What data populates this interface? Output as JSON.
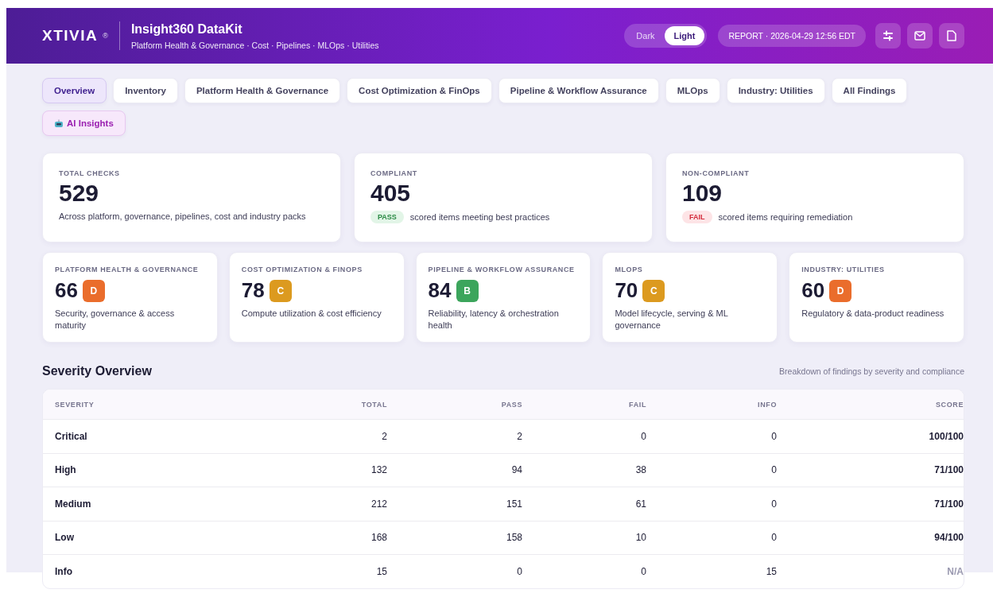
{
  "header": {
    "logo": "XTIVIA",
    "logo_mark": "®",
    "title": "Insight360 DataKit",
    "subtitle": "Platform Health & Governance · Cost · Pipelines · MLOps · Utilities",
    "theme_options": [
      {
        "label": "Dark",
        "selected": false
      },
      {
        "label": "Light",
        "selected": true
      }
    ],
    "report": "REPORT · 2026-04-29 12:56 EDT"
  },
  "tabs": [
    {
      "label": "Overview",
      "selected": true,
      "kind": "plain"
    },
    {
      "label": "Inventory",
      "selected": false,
      "kind": "plain"
    },
    {
      "label": "Platform Health & Governance",
      "selected": false,
      "kind": "plain"
    },
    {
      "label": "Cost Optimization & FinOps",
      "selected": false,
      "kind": "plain"
    },
    {
      "label": "Pipeline & Workflow Assurance",
      "selected": false,
      "kind": "plain"
    },
    {
      "label": "MLOps",
      "selected": false,
      "kind": "plain"
    },
    {
      "label": "Industry: Utilities",
      "selected": false,
      "kind": "plain"
    },
    {
      "label": "All Findings",
      "selected": false,
      "kind": "plain"
    },
    {
      "label": "AI Insights",
      "selected": false,
      "kind": "ai"
    }
  ],
  "summary": [
    {
      "label": "TOTAL CHECKS",
      "value": "529",
      "description": "Across platform, governance, pipelines, cost and industry packs"
    },
    {
      "label": "COMPLIANT",
      "value": "405",
      "badge": "PASS",
      "kind": "pass",
      "description": "scored items meeting best practices"
    },
    {
      "label": "NON-COMPLIANT",
      "value": "109",
      "badge": "FAIL",
      "kind": "fail",
      "description": "scored items requiring remediation"
    }
  ],
  "categories": [
    {
      "label": "PLATFORM HEALTH & GOVERNANCE",
      "score": "66",
      "grade": "D",
      "color": "#ea6d2c",
      "description": "Security, governance & access maturity"
    },
    {
      "label": "COST OPTIMIZATION & FINOPS",
      "score": "78",
      "grade": "C",
      "color": "#dc9a1f",
      "description": "Compute utilization & cost efficiency"
    },
    {
      "label": "PIPELINE & WORKFLOW ASSURANCE",
      "score": "84",
      "grade": "B",
      "color": "#3ca55c",
      "description": "Reliability, latency & orchestration health"
    },
    {
      "label": "MLOPS",
      "score": "70",
      "grade": "C",
      "color": "#dc9a1f",
      "description": "Model lifecycle, serving & ML governance"
    },
    {
      "label": "INDUSTRY: UTILITIES",
      "score": "60",
      "grade": "D",
      "color": "#ea6d2c",
      "description": "Regulatory & data-product readiness"
    }
  ],
  "severity": {
    "title": "Severity Overview",
    "caption": "Breakdown of findings by severity and compliance",
    "columns": [
      "SEVERITY",
      "TOTAL",
      "PASS",
      "FAIL",
      "INFO",
      "SCORE"
    ],
    "rows": [
      {
        "cells": [
          "Critical",
          "2",
          "2",
          "0",
          "0",
          "100/100"
        ],
        "muted_score": false
      },
      {
        "cells": [
          "High",
          "132",
          "94",
          "38",
          "0",
          "71/100"
        ],
        "muted_score": false
      },
      {
        "cells": [
          "Medium",
          "212",
          "151",
          "61",
          "0",
          "71/100"
        ],
        "muted_score": false
      },
      {
        "cells": [
          "Low",
          "168",
          "158",
          "10",
          "0",
          "94/100"
        ],
        "muted_score": false
      },
      {
        "cells": [
          "Info",
          "15",
          "0",
          "0",
          "15",
          "N/A"
        ],
        "muted_score": true
      }
    ]
  }
}
